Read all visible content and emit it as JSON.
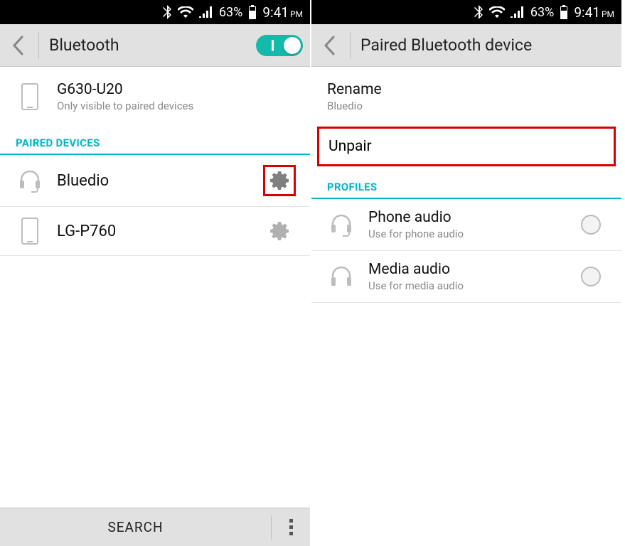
{
  "status": {
    "battery_pct": "63%",
    "time": "9:41",
    "ampm": "PM"
  },
  "left": {
    "title": "Bluetooth",
    "toggle_on": true,
    "device": {
      "name": "G630-U20",
      "sub": "Only visible to paired devices"
    },
    "section_paired": "PAIRED DEVICES",
    "paired": [
      {
        "name": "Bluedio",
        "icon": "headset",
        "highlight": true
      },
      {
        "name": "LG-P760",
        "icon": "phone",
        "highlight": false
      }
    ],
    "search_label": "SEARCH"
  },
  "right": {
    "title": "Paired Bluetooth device",
    "rename_label": "Rename",
    "rename_value": "Bluedio",
    "unpair_label": "Unpair",
    "profiles_header": "PROFILES",
    "profiles": [
      {
        "name": "Phone audio",
        "sub": "Use for phone audio",
        "icon": "headset"
      },
      {
        "name": "Media audio",
        "sub": "Use for media audio",
        "icon": "headphones"
      }
    ]
  }
}
